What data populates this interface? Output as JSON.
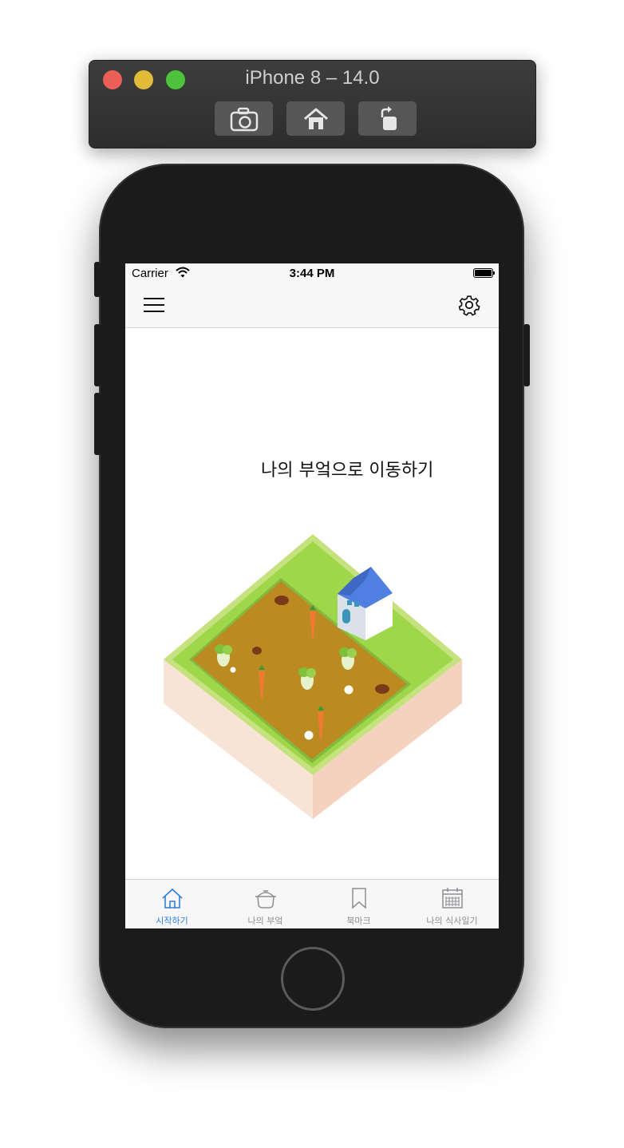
{
  "simulator": {
    "title": "iPhone 8 – 14.0",
    "toolbar": [
      "screenshot-button",
      "home-button",
      "rotate-button"
    ]
  },
  "status_bar": {
    "carrier": "Carrier",
    "time": "3:44 PM"
  },
  "nav_bar": {
    "left_icon": "menu-icon",
    "right_icon": "gear-icon"
  },
  "main": {
    "headline": "나의 부엌으로 이동하기",
    "illustration": "isometric-farm-with-house"
  },
  "tab_bar": {
    "active_index": 0,
    "accent_color": "#2f7fdc",
    "tabs": [
      {
        "label": "시작하기",
        "icon": "house-icon"
      },
      {
        "label": "나의 부엌",
        "icon": "pot-icon"
      },
      {
        "label": "북마크",
        "icon": "bookmark-icon"
      },
      {
        "label": "나의 식사일기",
        "icon": "calendar-icon"
      }
    ]
  }
}
